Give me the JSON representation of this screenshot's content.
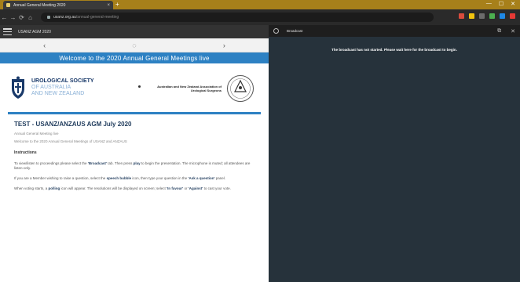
{
  "browser": {
    "tab_title": "Annual General Meeting 2020",
    "tab_close": "×",
    "new_tab": "+",
    "window_controls": [
      "—",
      "☐",
      "✕"
    ],
    "nav": [
      "←",
      "→",
      "⟳",
      "⌂"
    ],
    "url_host": "usanz.org.au",
    "url_path": "/annual-general-meeting",
    "extensions": [
      "#d94c3d",
      "#f1c40f",
      "#6c6c6c",
      "#4caf50",
      "#1e88e5",
      "#e53935"
    ]
  },
  "app": {
    "header_title": "USANZ AGM 2020",
    "slide_controls": [
      "‹",
      "◌",
      "›"
    ],
    "banner": "Welcome to the 2020 Annual General Meetings live",
    "org_left": [
      "UROLOGICAL SOCIETY",
      "OF AUSTRALIA",
      "AND NEW ZEALAND"
    ],
    "org_right": "Australian and New Zealand Association of Urological Surgeons",
    "event_title": "TEST - USANZ/ANZAUS AGM July 2020",
    "meta": "Annual General Meeting live",
    "lead": "Welcome to the 2020 Annual General Meetings of USANZ and ANZAUS",
    "instructions_heading": "Instructions",
    "para1_pre": "To view/listen to proceedings please select the ",
    "para1_b1": "'Broadcast'",
    "para1_mid": " tab. Then press ",
    "para1_b2": "play",
    "para1_post": " to begin the presentation. The microphone is muted; all attendees are listen-only.",
    "para2_pre": "If you are a Member wishing to raise a question, select the ",
    "para2_b1": "speech bubble",
    "para2_mid": " icon, then type your question in the ",
    "para2_b2": "'Ask a question'",
    "para2_post": " panel.",
    "para3_pre": "When voting starts, a ",
    "para3_b1": "polling",
    "para3_mid": " icon will appear. The resolutions will be displayed on screen; select ",
    "para3_b2": "'In favour'",
    "para3_mid2": " or ",
    "para3_b3": "'Against'",
    "para3_post": " to cast your vote."
  },
  "panel": {
    "title": "Broadcast",
    "icons": [
      "⧉",
      "✕"
    ],
    "notice": "The broadcast has not started. Please wait here for the broadcast to begin."
  },
  "colors": {
    "accent": "#2d81c3",
    "panel_bg": "#26323b",
    "tabstrip": "#a7801a"
  }
}
